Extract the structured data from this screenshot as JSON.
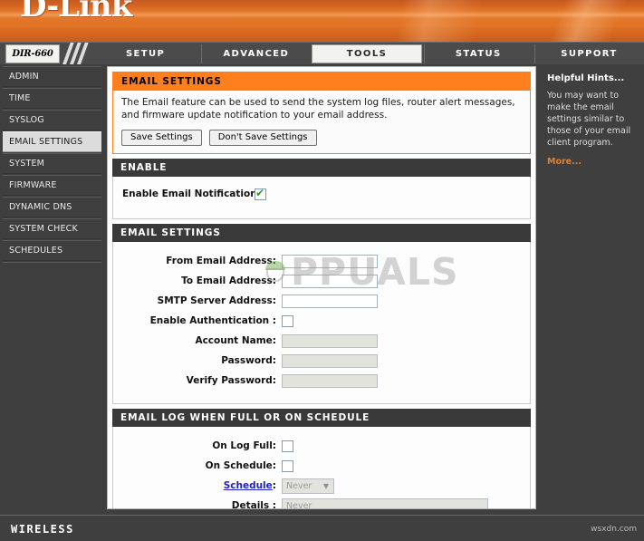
{
  "banner": {
    "logo": "D-Link"
  },
  "nav": {
    "model": "DIR-660",
    "tabs": [
      {
        "label": "SETUP",
        "active": false
      },
      {
        "label": "ADVANCED",
        "active": false
      },
      {
        "label": "TOOLS",
        "active": true
      },
      {
        "label": "STATUS",
        "active": false
      },
      {
        "label": "SUPPORT",
        "active": false
      }
    ]
  },
  "sidebar": {
    "items": [
      {
        "label": "ADMIN",
        "active": false
      },
      {
        "label": "TIME",
        "active": false
      },
      {
        "label": "SYSLOG",
        "active": false
      },
      {
        "label": "EMAIL SETTINGS",
        "active": true
      },
      {
        "label": "SYSTEM",
        "active": false
      },
      {
        "label": "FIRMWARE",
        "active": false
      },
      {
        "label": "DYNAMIC DNS",
        "active": false
      },
      {
        "label": "SYSTEM CHECK",
        "active": false
      },
      {
        "label": "SCHEDULES",
        "active": false
      }
    ]
  },
  "main": {
    "intro": {
      "title": "EMAIL SETTINGS",
      "description": "The Email feature can be used to send the system log files, router alert messages, and firmware update notification to your email address.",
      "save_label": "Save Settings",
      "dont_save_label": "Don't Save Settings"
    },
    "enable": {
      "title": "ENABLE",
      "notification_label": "Enable Email Notification :",
      "notification_checked": true
    },
    "email_settings": {
      "title": "EMAIL SETTINGS",
      "from_label": "From Email Address:",
      "from_value": "",
      "to_label": "To Email Address:",
      "to_value": "",
      "smtp_label": "SMTP Server Address:",
      "smtp_value": "",
      "auth_label": "Enable Authentication :",
      "auth_checked": false,
      "account_label": "Account Name:",
      "account_value": "",
      "password_label": "Password:",
      "password_value": "",
      "verify_label": "Verify Password:",
      "verify_value": ""
    },
    "email_log": {
      "title": "EMAIL LOG WHEN FULL OR ON SCHEDULE",
      "on_log_full_label": "On Log Full:",
      "on_log_full_checked": false,
      "on_schedule_label": "On Schedule:",
      "on_schedule_checked": false,
      "schedule_link": "Schedule",
      "schedule_colon": ":",
      "schedule_value": "Never",
      "details_label": "Details :",
      "details_value": "Never"
    }
  },
  "hints": {
    "title": "Helpful Hints...",
    "body": "You may want to make the email settings similar to those of your email client program.",
    "more": "More..."
  },
  "footer": {
    "wireless": "WIRELESS",
    "credit": "wsxdn.com"
  },
  "watermark": {
    "text": "PPUALS"
  },
  "colors": {
    "banner_orange": "#e0752a",
    "header_orange": "#ff7f1f",
    "panel_dark": "#3a3a3a",
    "chrome_gray": "#3f3f3f",
    "link_blue": "#2020c8",
    "hint_more": "#e08030",
    "check_green": "#2f9e2f"
  }
}
